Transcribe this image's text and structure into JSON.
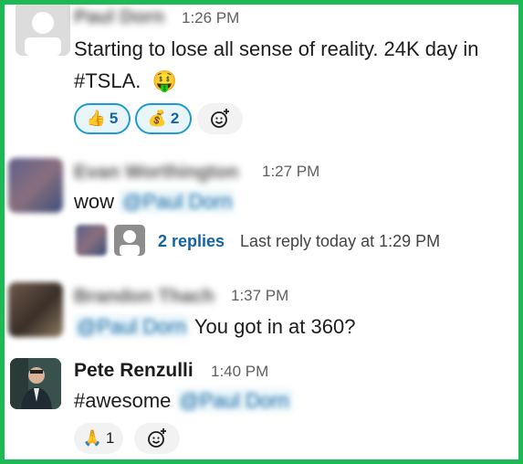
{
  "messages": [
    {
      "author": "Paul Dorn",
      "time": "1:26 PM",
      "text_line1": "Starting to lose all sense of reality.  24K day in",
      "text_line2": "#TSLA.",
      "emoji": "🤑",
      "reactions": [
        {
          "emoji": "👍",
          "count": "5"
        },
        {
          "emoji": "💰",
          "count": "2"
        }
      ]
    },
    {
      "author": "Evan Worthington",
      "time": "1:27 PM",
      "text": "wow",
      "mention": "@Paul Dorn",
      "replies_label": "2 replies",
      "replies_meta": "Last reply today at 1:29 PM"
    },
    {
      "author": "Brandon Thach",
      "time": "1:37 PM",
      "mention": "@Paul Dorn",
      "text": "You got in at 360?"
    },
    {
      "author": "Pete Renzulli",
      "time": "1:40 PM",
      "text": "#awesome",
      "mention": "@Paul Dorn",
      "reactions": [
        {
          "emoji": "🙏",
          "count": "1"
        }
      ]
    }
  ],
  "icons": {
    "add_reaction": "add-reaction-icon"
  },
  "colors": {
    "border": "#1db954",
    "link": "#1264a3",
    "reaction_active_border": "#1d9bd1"
  }
}
